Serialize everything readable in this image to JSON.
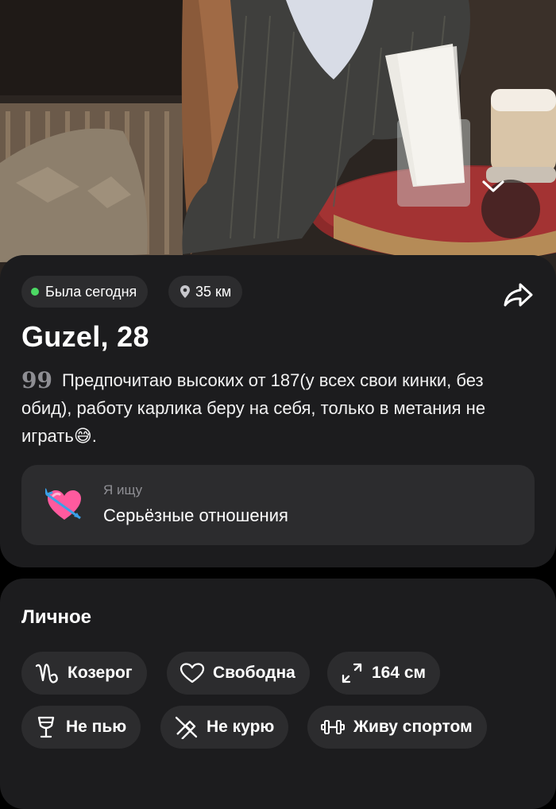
{
  "profile": {
    "status": "Была сегодня",
    "distance": "35 км",
    "name_age": "Guzel, 28",
    "bio": "Предпочитаю высоких от 187(у всех свои кинки, без обид), работу карлика беру на себя, только в метания не играть😅.",
    "quote_glyph": "99"
  },
  "looking_for": {
    "caption": "Я ищу",
    "value": "Серьёзные отношения",
    "emoji": "💘"
  },
  "personal": {
    "title": "Личное",
    "tags": [
      {
        "label": "Козерог",
        "icon": "capricorn-icon"
      },
      {
        "label": "Свободна",
        "icon": "heart-icon"
      },
      {
        "label": "164 см",
        "icon": "height-arrows-icon"
      },
      {
        "label": "Не пью",
        "icon": "wine-glass-icon"
      },
      {
        "label": "Не курю",
        "icon": "no-smoking-icon"
      },
      {
        "label": "Живу спортом",
        "icon": "dumbbell-icon"
      }
    ]
  },
  "colors": {
    "card_bg": "#1c1c1e",
    "chip_bg": "#2c2c2e",
    "online_dot": "#4cd964",
    "muted_text": "#8e8e93"
  }
}
